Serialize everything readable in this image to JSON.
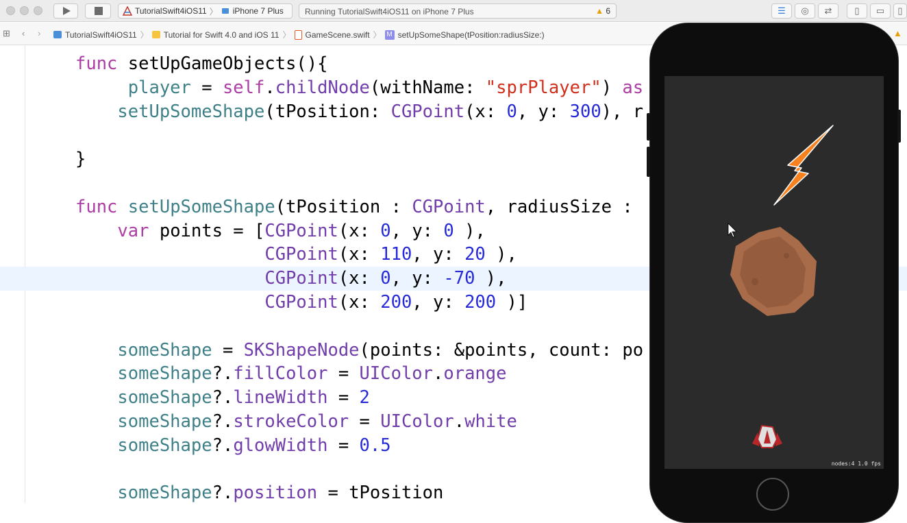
{
  "toolbar": {
    "scheme_name": "TutorialSwift4iOS11",
    "device_name": "iPhone 7 Plus",
    "status_text": "Running TutorialSwift4iOS11 on iPhone 7 Plus",
    "warning_count": "6"
  },
  "breadcrumb": {
    "project": "TutorialSwift4iOS11",
    "folder": "Tutorial for Swift 4.0 and iOS 11",
    "file": "GameScene.swift",
    "symbol_badge": "M",
    "symbol": "setUpSomeShape(tPosition:radiusSize:)"
  },
  "editor": {
    "lines": [
      "func setUpGameObjects(){",
      "     player = self.childNode(withName: \"sprPlayer\") as",
      "    setUpSomeShape(tPosition: CGPoint(x: 0, y: 300), r",
      "",
      "}",
      "",
      "func setUpSomeShape(tPosition : CGPoint, radiusSize :",
      "    var points = [CGPoint(x: 0, y: 0 ),",
      "                  CGPoint(x: 110, y: 20 ),",
      "                  CGPoint(x: 0, y: -70 ),",
      "                  CGPoint(x: 200, y: 200 )]",
      "",
      "    someShape = SKShapeNode(points: &points, count: po",
      "    someShape?.fillColor = UIColor.orange",
      "    someShape?.lineWidth = 2",
      "    someShape?.strokeColor = UIColor.white",
      "    someShape?.glowWidth = 0.5",
      "",
      "    someShape?.position = tPosition"
    ],
    "highlighted_line": 9
  },
  "simulator": {
    "stats": "nodes:4  1.0 fps",
    "background_color": "#2b2b2b",
    "shape_color": "#f7811e",
    "asteroid_color": "#a86c4a"
  },
  "colors": {
    "keyword": "#ad3da4",
    "type": "#703daa",
    "property": "#3e8087",
    "number": "#272ad8",
    "string": "#d12f1b",
    "line_highlight": "#ecf5ff"
  }
}
